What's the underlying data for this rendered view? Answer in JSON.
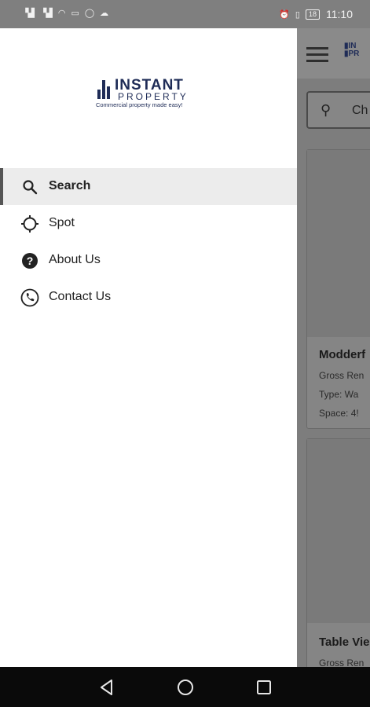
{
  "status_bar": {
    "left_icons": [
      "signal-icon",
      "signal-icon",
      "wifi-icon",
      "screen-cast-icon",
      "whatsapp-icon",
      "cloud-icon"
    ],
    "signal1": "⨲ıl",
    "signal2": "⨲ıl",
    "battery": "18",
    "time": "11:10"
  },
  "drawer": {
    "logo": {
      "line1": "INSTANT",
      "line2": "PROPERTY",
      "tagline": "Commercial property made easy!"
    },
    "menu": [
      {
        "label": "Search",
        "icon": "search-icon",
        "active": true
      },
      {
        "label": "Spot",
        "icon": "crosshair-icon",
        "active": false
      },
      {
        "label": "About Us",
        "icon": "question-circle-icon",
        "active": false
      },
      {
        "label": "Contact Us",
        "icon": "phone-icon",
        "active": false
      }
    ]
  },
  "background_app": {
    "search_placeholder": "Ch",
    "cards": [
      {
        "title": "Modderf",
        "lines": [
          "Gross Ren",
          "Type:  Wa",
          "Space:  4!"
        ]
      },
      {
        "title": "Table Vie",
        "lines": [
          "Gross Ren"
        ]
      }
    ]
  },
  "colors": {
    "brand": "#1f2c57",
    "scrim": "#7f7f7f",
    "active_bg": "#ececec"
  }
}
